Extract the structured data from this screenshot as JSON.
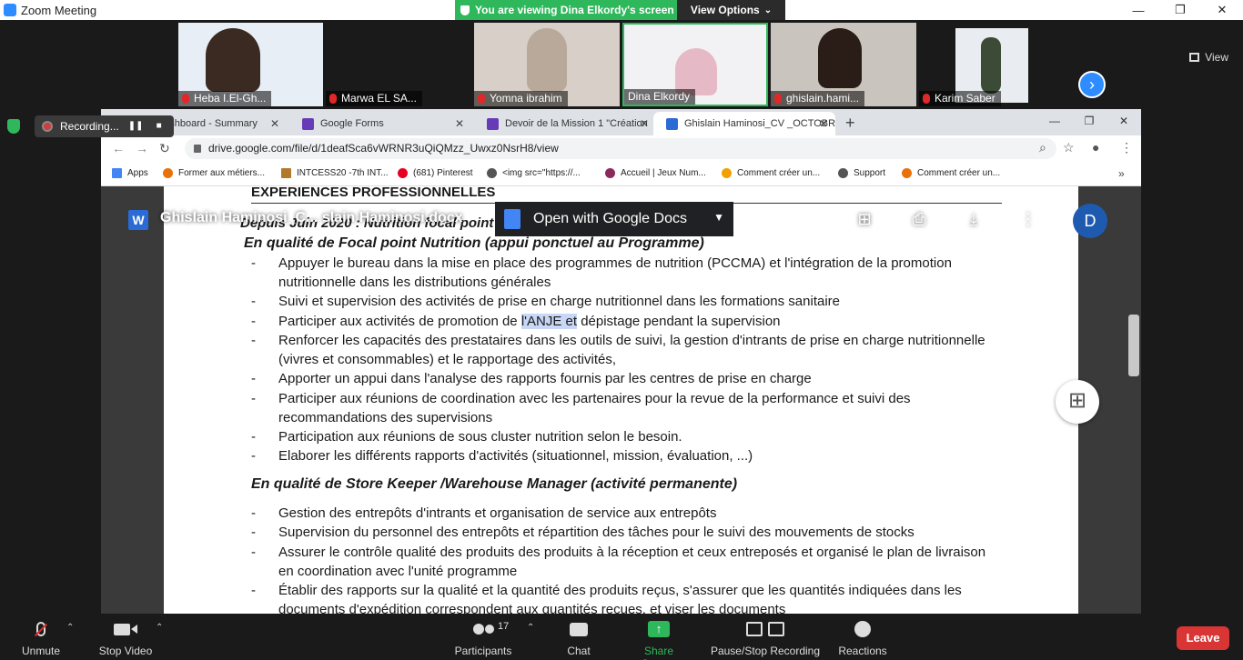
{
  "zoom": {
    "window_title": "Zoom Meeting",
    "banner_text": "You are viewing Dina Elkordy's screen",
    "view_options_label": "View Options",
    "view_options_caret": "⌄",
    "view_label": "View",
    "recording_label": "Recording...",
    "participants": [
      {
        "name": "Heba I.El-Gh...",
        "bg": "#e8eef5"
      },
      {
        "name": "Marwa EL SA...",
        "bg": "#1a1a1a"
      },
      {
        "name": "Yomna ibrahim",
        "bg": "#d8d0c8"
      },
      {
        "name": "Dina Elkordy",
        "bg": "#f2f2f5"
      },
      {
        "name": "ghislain.hami...",
        "bg": "#c9c4bd"
      },
      {
        "name": "Karim Saber",
        "bg": "#e9edf1"
      }
    ],
    "bottom_bar": {
      "unmute": "Unmute",
      "stop_video": "Stop Video",
      "participants": "Participants",
      "participants_count": "17",
      "chat": "Chat",
      "share_screen": "Share Screen",
      "recording": "Pause/Stop Recording",
      "reactions": "Reactions",
      "leave": "Leave"
    }
  },
  "browser": {
    "tabs": [
      {
        "label": "Live Dashboard - Summary",
        "color": "#5a2d82"
      },
      {
        "label": "Google Forms",
        "color": "#673ab7"
      },
      {
        "label": "Devoir de la Mission 1 \"Création",
        "color": "#673ab7"
      },
      {
        "label": "Ghislain Haminosi_CV _OCTOBRE",
        "color": "#2a6bd6"
      }
    ],
    "url": "drive.google.com/file/d/1deafSca6vWRNR3uQiQMzz_Uwxz0NsrH8/view",
    "bookmarks": [
      {
        "label": "Apps",
        "color": "#4285f4"
      },
      {
        "label": "Former aux métiers...",
        "color": "#e8710a"
      },
      {
        "label": "INTCESS20 -7th INT...",
        "color": "#b07a2a"
      },
      {
        "label": "(681) Pinterest",
        "color": "#e60023"
      },
      {
        "label": "<img src=\"https://...",
        "color": "#555555"
      },
      {
        "label": "Accueil | Jeux Num...",
        "color": "#8a2a5a"
      },
      {
        "label": "Comment créer un...",
        "color": "#f2a000"
      },
      {
        "label": "Support",
        "color": "#555555"
      },
      {
        "label": "Comment créer un...",
        "color": "#e8710a"
      }
    ]
  },
  "drive": {
    "file_title": "Ghislain Haminosi_C... slain Haminosi.docx",
    "open_with_label": "Open with Google Docs",
    "avatar_initial": "D"
  },
  "document": {
    "section_title": "EXPERIENCES PROFESSIONNELLES",
    "date_line": "Depuis Juin 2020 : Nutrition focal point ... au Bureau de PAM BENI",
    "role1": "En qualité de Focal point Nutrition (appui ponctuel au Programme)",
    "role1_items": [
      "Appuyer le bureau dans la mise en place des programmes de nutrition (PCCMA) et l'intégration de la promotion",
      "nutritionnelle dans les distributions générales",
      "Suivi et supervision des activités de prise en charge nutritionnel dans les formations sanitaire",
      "Participer aux activités de promotion de ",
      "l'ANJE et",
      " dépistage pendant la supervision",
      "Renforcer les capacités des prestataires dans les outils de suivi, la gestion d'intrants de prise en charge nutritionnelle",
      "(vivres et consommables) et le rapportage des activités,",
      "Apporter un appui dans l'analyse des rapports fournis par les centres de prise en charge",
      "Participer aux réunions de coordination avec les partenaires pour la revue de la performance et suivi des",
      "recommandations des supervisions",
      "Participation aux réunions de sous cluster nutrition selon le besoin.",
      "Elaborer les différents rapports d'activités (situationnel, mission, évaluation, ...)"
    ],
    "role2": "En qualité de Store Keeper /Warehouse Manager (activité permanente)",
    "role2_items": [
      "Gestion des entrepôts d'intrants et organisation de service aux entrepôts",
      "Supervision du personnel des entrepôts et répartition des tâches pour le suivi des mouvements de stocks",
      "Assurer le contrôle qualité des produits des produits à la réception et ceux entreposés et organisé le plan de livraison",
      "en coordination avec l'unité programme",
      "Établir des rapports sur la qualité et la quantité des produits reçus, s'assurer que les quantités indiquées dans les",
      "documents d'expédition correspondent aux quantités reçues, et viser les documents"
    ]
  }
}
